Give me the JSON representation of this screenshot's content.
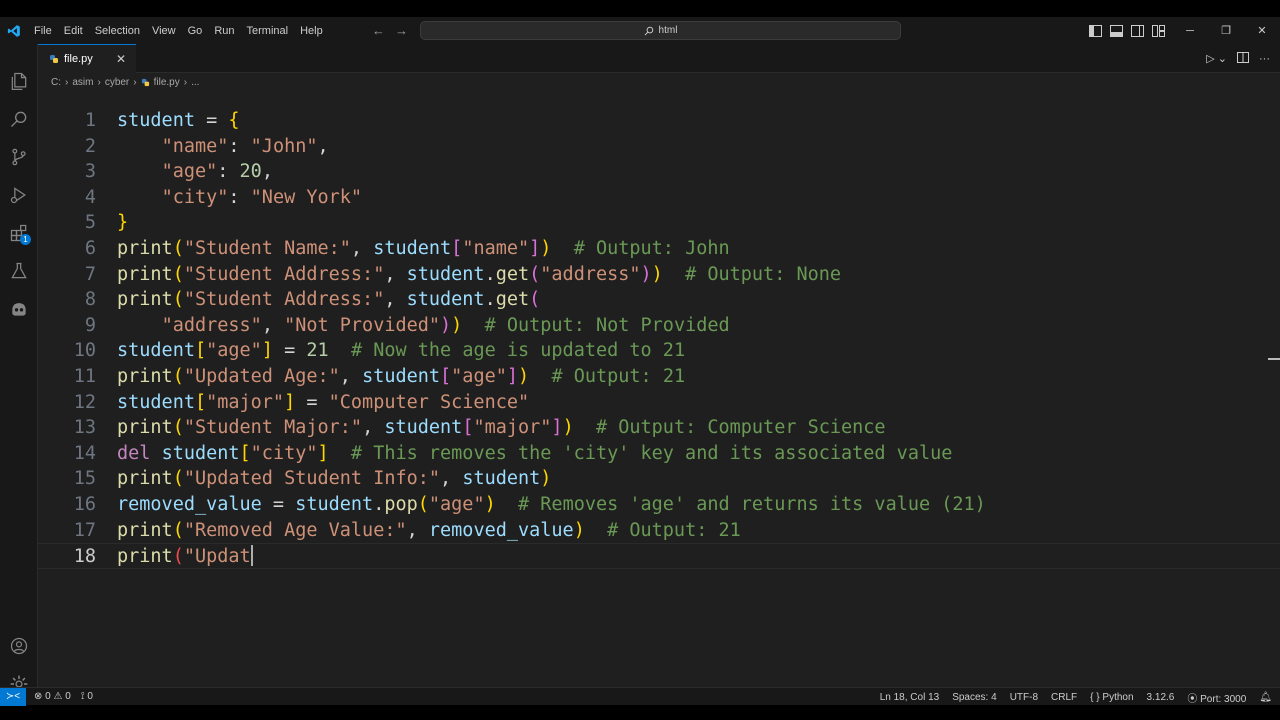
{
  "titlebar": {
    "menu": [
      "File",
      "Edit",
      "Selection",
      "View",
      "Go",
      "Run",
      "Terminal",
      "Help"
    ],
    "search_text": "html"
  },
  "tab": {
    "filename": "file.py"
  },
  "breadcrumb": [
    "C:",
    "asim",
    "cyber",
    "file.py",
    "..."
  ],
  "editor": {
    "lines": [
      [
        [
          "var",
          "student"
        ],
        [
          "op",
          " = "
        ],
        [
          "b1",
          "{"
        ]
      ],
      [
        [
          "op",
          "    "
        ],
        [
          "str",
          "\"name\""
        ],
        [
          "op",
          ": "
        ],
        [
          "str",
          "\"John\""
        ],
        [
          "op",
          ","
        ]
      ],
      [
        [
          "op",
          "    "
        ],
        [
          "str",
          "\"age\""
        ],
        [
          "op",
          ": "
        ],
        [
          "num",
          "20"
        ],
        [
          "op",
          ","
        ]
      ],
      [
        [
          "op",
          "    "
        ],
        [
          "str",
          "\"city\""
        ],
        [
          "op",
          ": "
        ],
        [
          "str",
          "\"New York\""
        ]
      ],
      [
        [
          "b1",
          "}"
        ]
      ],
      [
        [
          "fn",
          "print"
        ],
        [
          "b1",
          "("
        ],
        [
          "str",
          "\"Student Name:\""
        ],
        [
          "op",
          ", "
        ],
        [
          "var",
          "student"
        ],
        [
          "b2",
          "["
        ],
        [
          "str",
          "\"name\""
        ],
        [
          "b2",
          "]"
        ],
        [
          "b1",
          ")"
        ],
        [
          "op",
          "  "
        ],
        [
          "com",
          "# Output: John"
        ]
      ],
      [
        [
          "fn",
          "print"
        ],
        [
          "b1",
          "("
        ],
        [
          "str",
          "\"Student Address:\""
        ],
        [
          "op",
          ", "
        ],
        [
          "var",
          "student"
        ],
        [
          "op",
          "."
        ],
        [
          "fn",
          "get"
        ],
        [
          "b2",
          "("
        ],
        [
          "str",
          "\"address\""
        ],
        [
          "b2",
          ")"
        ],
        [
          "b1",
          ")"
        ],
        [
          "op",
          "  "
        ],
        [
          "com",
          "# Output: None"
        ]
      ],
      [
        [
          "fn",
          "print"
        ],
        [
          "b1",
          "("
        ],
        [
          "str",
          "\"Student Address:\""
        ],
        [
          "op",
          ", "
        ],
        [
          "var",
          "student"
        ],
        [
          "op",
          "."
        ],
        [
          "fn",
          "get"
        ],
        [
          "b2",
          "("
        ]
      ],
      [
        [
          "op",
          "    "
        ],
        [
          "str",
          "\"address\""
        ],
        [
          "op",
          ", "
        ],
        [
          "str",
          "\"Not Provided\""
        ],
        [
          "b2",
          ")"
        ],
        [
          "b1",
          ")"
        ],
        [
          "op",
          "  "
        ],
        [
          "com",
          "# Output: Not Provided"
        ]
      ],
      [
        [
          "var",
          "student"
        ],
        [
          "b1",
          "["
        ],
        [
          "str",
          "\"age\""
        ],
        [
          "b1",
          "]"
        ],
        [
          "op",
          " = "
        ],
        [
          "num",
          "21"
        ],
        [
          "op",
          "  "
        ],
        [
          "com",
          "# Now the age is updated to 21"
        ]
      ],
      [
        [
          "fn",
          "print"
        ],
        [
          "b1",
          "("
        ],
        [
          "str",
          "\"Updated Age:\""
        ],
        [
          "op",
          ", "
        ],
        [
          "var",
          "student"
        ],
        [
          "b2",
          "["
        ],
        [
          "str",
          "\"age\""
        ],
        [
          "b2",
          "]"
        ],
        [
          "b1",
          ")"
        ],
        [
          "op",
          "  "
        ],
        [
          "com",
          "# Output: 21"
        ]
      ],
      [
        [
          "var",
          "student"
        ],
        [
          "b1",
          "["
        ],
        [
          "str",
          "\"major\""
        ],
        [
          "b1",
          "]"
        ],
        [
          "op",
          " = "
        ],
        [
          "str",
          "\"Computer Science\""
        ]
      ],
      [
        [
          "fn",
          "print"
        ],
        [
          "b1",
          "("
        ],
        [
          "str",
          "\"Student Major:\""
        ],
        [
          "op",
          ", "
        ],
        [
          "var",
          "student"
        ],
        [
          "b2",
          "["
        ],
        [
          "str",
          "\"major\""
        ],
        [
          "b2",
          "]"
        ],
        [
          "b1",
          ")"
        ],
        [
          "op",
          "  "
        ],
        [
          "com",
          "# Output: Computer Science"
        ]
      ],
      [
        [
          "kw",
          "del"
        ],
        [
          "op",
          " "
        ],
        [
          "var",
          "student"
        ],
        [
          "b1",
          "["
        ],
        [
          "str",
          "\"city\""
        ],
        [
          "b1",
          "]"
        ],
        [
          "op",
          "  "
        ],
        [
          "com",
          "# This removes the 'city' key and its associated value"
        ]
      ],
      [
        [
          "fn",
          "print"
        ],
        [
          "b1",
          "("
        ],
        [
          "str",
          "\"Updated Student Info:\""
        ],
        [
          "op",
          ", "
        ],
        [
          "var",
          "student"
        ],
        [
          "b1",
          ")"
        ]
      ],
      [
        [
          "var",
          "removed_value"
        ],
        [
          "op",
          " = "
        ],
        [
          "var",
          "student"
        ],
        [
          "op",
          "."
        ],
        [
          "fn",
          "pop"
        ],
        [
          "b1",
          "("
        ],
        [
          "str",
          "\"age\""
        ],
        [
          "b1",
          ")"
        ],
        [
          "op",
          "  "
        ],
        [
          "com",
          "# Removes 'age' and returns its value (21)"
        ]
      ],
      [
        [
          "fn",
          "print"
        ],
        [
          "b1",
          "("
        ],
        [
          "str",
          "\"Removed Age Value:\""
        ],
        [
          "op",
          ", "
        ],
        [
          "var",
          "removed_value"
        ],
        [
          "b1",
          ")"
        ],
        [
          "op",
          "  "
        ],
        [
          "com",
          "# Output: 21"
        ]
      ],
      [
        [
          "fn",
          "print"
        ],
        [
          "err",
          "("
        ],
        [
          "str",
          "\"Updat"
        ]
      ]
    ],
    "current_line": 18
  },
  "activity_badge": "1",
  "status": {
    "errors": "0",
    "warnings": "0",
    "ports": "0",
    "position": "Ln 18, Col 13",
    "spaces": "Spaces: 4",
    "encoding": "UTF-8",
    "eol": "CRLF",
    "language": "Python",
    "version": "3.12.6",
    "port": "Port: 3000"
  },
  "colors": {
    "accent": "#0078d4"
  }
}
